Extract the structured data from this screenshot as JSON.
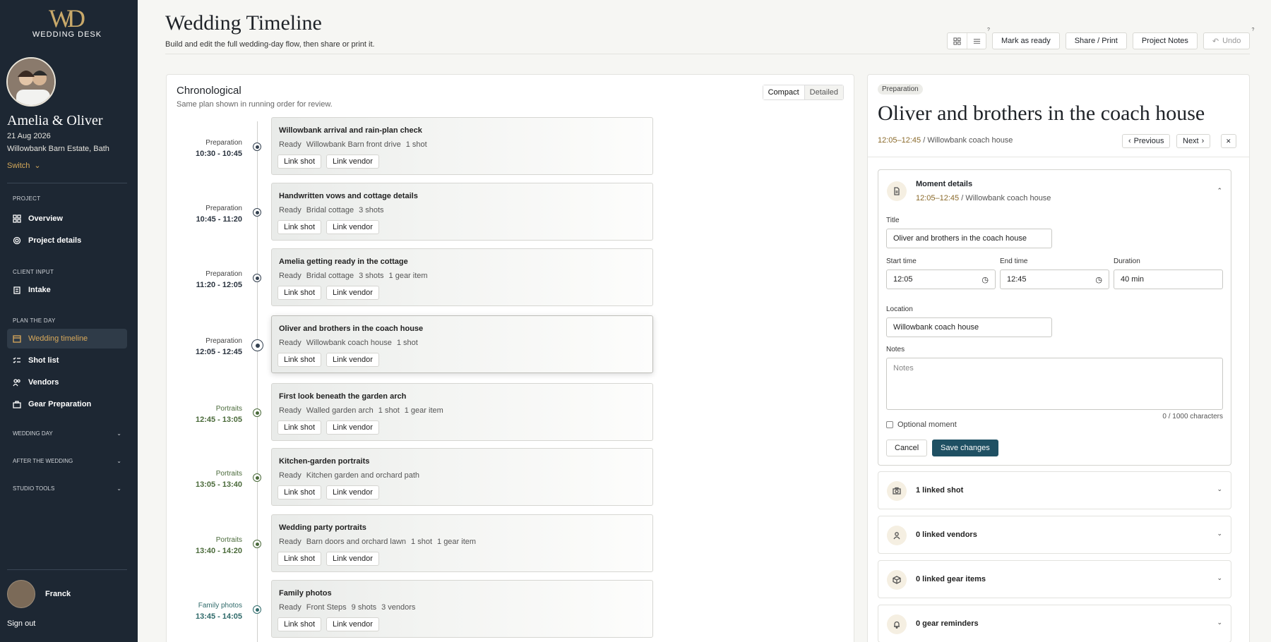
{
  "brand": {
    "monogram": "WD",
    "name": "WEDDING DESK"
  },
  "project": {
    "couple": "Amelia & Oliver",
    "date": "21 Aug 2026",
    "venue": "Willowbank Barn Estate, Bath",
    "switch_label": "Switch"
  },
  "sidebar": {
    "sections": [
      "PROJECT",
      "CLIENT INPUT",
      "PLAN THE DAY"
    ],
    "items": [
      {
        "label": "Overview",
        "icon": "grid-icon"
      },
      {
        "label": "Project details",
        "icon": "gear-icon"
      },
      {
        "label": "Intake",
        "icon": "clipboard-icon"
      },
      {
        "label": "Wedding timeline",
        "icon": "calendar-icon"
      },
      {
        "label": "Shot list",
        "icon": "checklist-icon"
      },
      {
        "label": "Vendors",
        "icon": "users-icon"
      },
      {
        "label": "Gear Preparation",
        "icon": "briefcase-icon"
      }
    ],
    "collapsed": [
      "WEDDING DAY",
      "AFTER THE WEDDING",
      "STUDIO TOOLS"
    ],
    "user": "Franck",
    "signout": "Sign out",
    "accent": "#d9a95a"
  },
  "header": {
    "title": "Wedding Timeline",
    "subtitle": "Build and edit the full wedding-day flow, then share or print it."
  },
  "toolbar": {
    "mark_ready": "Mark as ready",
    "share": "Share / Print",
    "notes": "Project Notes",
    "undo": "Undo",
    "help": "?"
  },
  "timeline": {
    "title": "Chronological",
    "subtitle": "Same plan shown in running order for review.",
    "view_compact": "Compact",
    "view_detailed": "Detailed",
    "link_shot": "Link shot",
    "link_vendor": "Link vendor",
    "rows": [
      {
        "phase": "Preparation",
        "time": "10:30 - 10:45",
        "title": "Willowbank arrival and rain-plan check",
        "meta": [
          "Ready",
          "Willowbank Barn front drive",
          "1 shot"
        ]
      },
      {
        "phase": "Preparation",
        "time": "10:45 - 11:20",
        "title": "Handwritten vows and cottage details",
        "meta": [
          "Ready",
          "Bridal cottage",
          "3 shots"
        ]
      },
      {
        "phase": "Preparation",
        "time": "11:20 - 12:05",
        "title": "Amelia getting ready in the cottage",
        "meta": [
          "Ready",
          "Bridal cottage",
          "3 shots",
          "1 gear item"
        ]
      },
      {
        "phase": "Preparation",
        "time": "12:05 - 12:45",
        "title": "Oliver and brothers in the coach house",
        "meta": [
          "Ready",
          "Willowbank coach house",
          "1 shot"
        ]
      },
      {
        "phase": "Portraits",
        "time": "12:45 - 13:05",
        "title": "First look beneath the garden arch",
        "meta": [
          "Ready",
          "Walled garden arch",
          "1 shot",
          "1 gear item"
        ]
      },
      {
        "phase": "Portraits",
        "time": "13:05 - 13:40",
        "title": "Kitchen-garden portraits",
        "meta": [
          "Ready",
          "Kitchen garden and orchard path"
        ]
      },
      {
        "phase": "Portraits",
        "time": "13:40 - 14:20",
        "title": "Wedding party portraits",
        "meta": [
          "Ready",
          "Barn doors and orchard lawn",
          "1 shot",
          "1 gear item"
        ]
      },
      {
        "phase": "Family photos",
        "time": "13:45 - 14:05",
        "title": "Family photos",
        "meta": [
          "Ready",
          "Front Steps",
          "9 shots",
          "3 vendors"
        ]
      }
    ],
    "colors": {
      "Preparation": "#344150",
      "Portraits": "#4a6a3a",
      "Family photos": "#2f6a6a"
    }
  },
  "detail": {
    "tag": "Preparation",
    "title": "Oliver and brothers in the coach house",
    "time": "12:05–12:45",
    "sep": "/",
    "location": "Willowbank coach house",
    "previous": "Previous",
    "next": "Next",
    "close": "✕",
    "moment": {
      "heading": "Moment details",
      "title_label": "Title",
      "title_value": "Oliver and brothers in the coach house",
      "start_label": "Start time",
      "start_value": "12:05",
      "end_label": "End time",
      "end_value": "12:45",
      "duration_label": "Duration",
      "duration_value": "40 min",
      "location_label": "Location",
      "location_value": "Willowbank coach house",
      "notes_label": "Notes",
      "notes_placeholder": "Notes",
      "char_count": "0 / 1000 characters",
      "optional": "Optional moment",
      "cancel": "Cancel",
      "save": "Save changes"
    },
    "accordions": [
      {
        "label": "1 linked shot",
        "icon": "camera-icon"
      },
      {
        "label": "0 linked vendors",
        "icon": "user-icon"
      },
      {
        "label": "0 linked gear items",
        "icon": "box-icon"
      },
      {
        "label": "0 gear reminders",
        "icon": "bell-icon"
      }
    ]
  }
}
